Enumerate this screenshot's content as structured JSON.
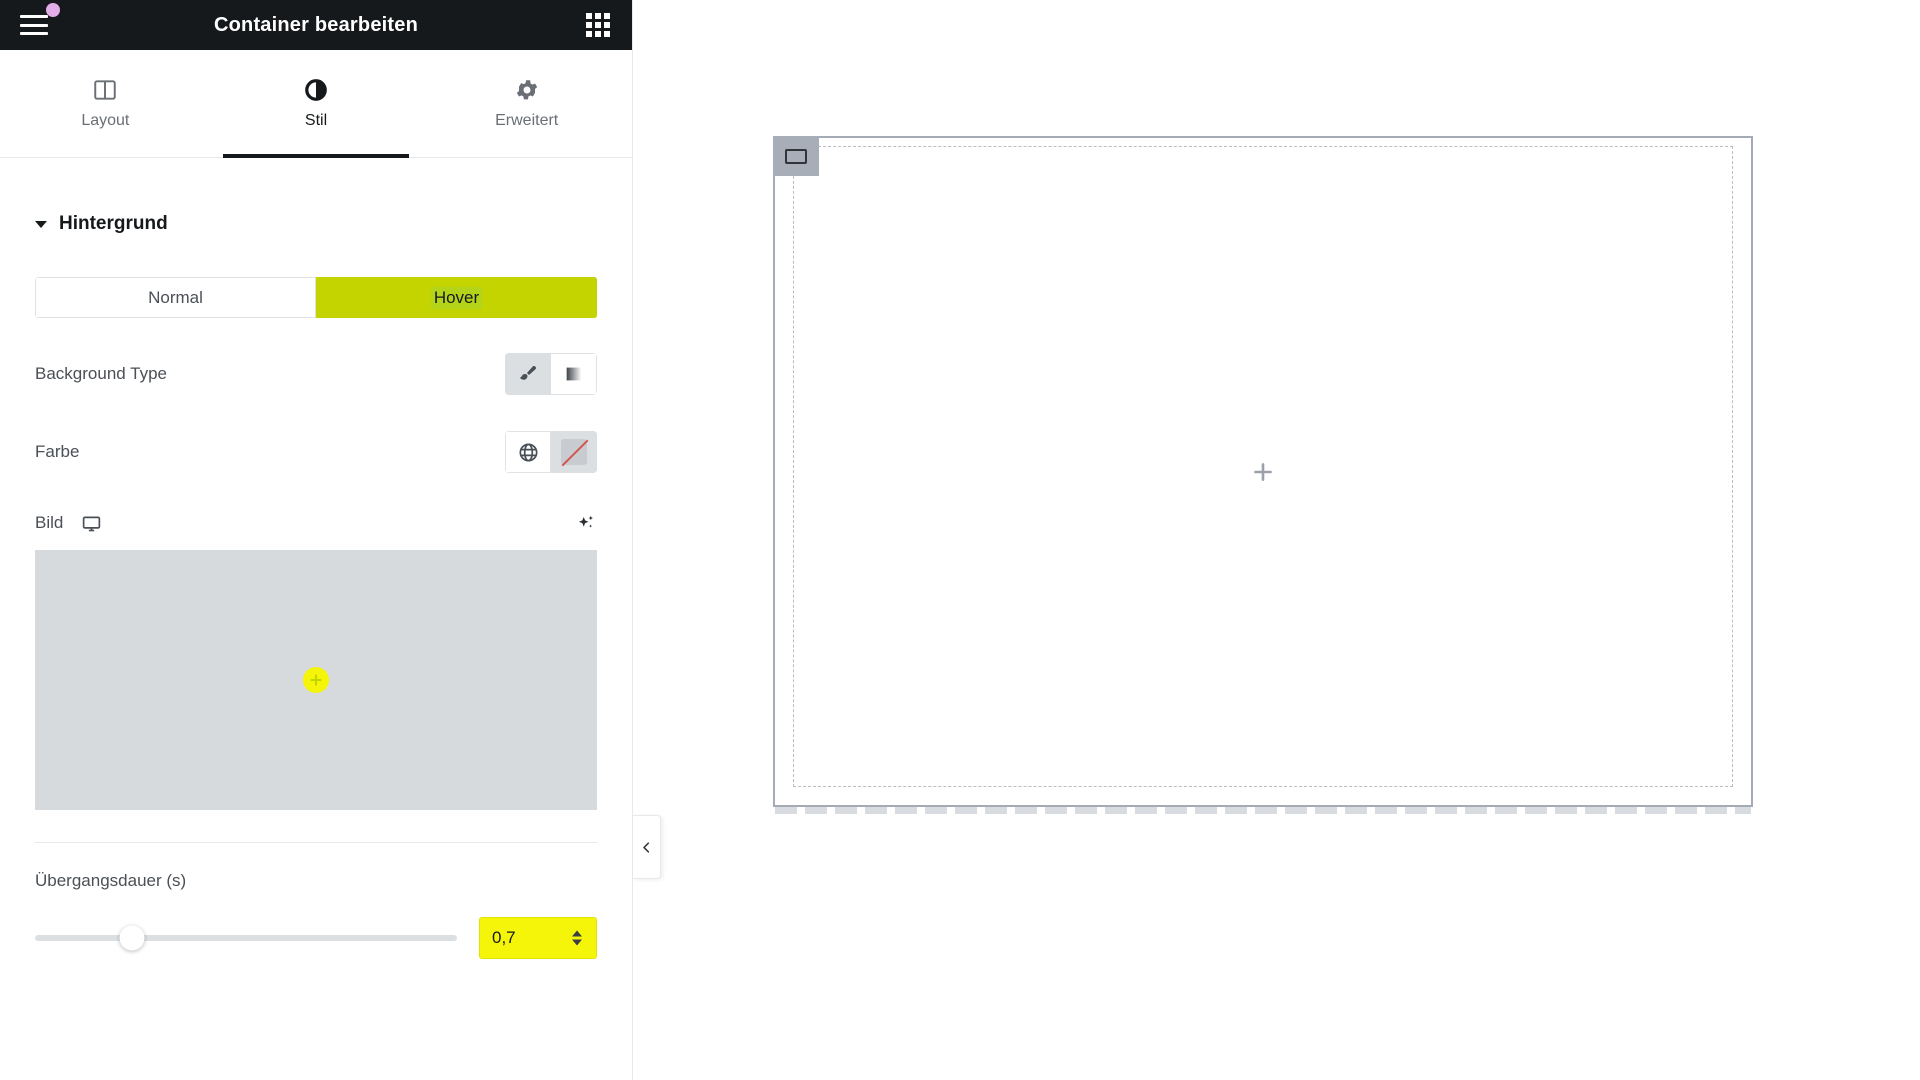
{
  "panel": {
    "header": {
      "title": "Container bearbeiten",
      "menu_icon": "hamburger-menu-icon",
      "notification_dot": "notification-dot",
      "widgets_icon": "grid-widgets-icon"
    },
    "tabs": [
      {
        "id": "layout",
        "label": "Layout",
        "icon": "columns-layout-icon",
        "active": false
      },
      {
        "id": "stil",
        "label": "Stil",
        "icon": "contrast-style-icon",
        "active": true
      },
      {
        "id": "erweitert",
        "label": "Erweitert",
        "icon": "gear-advanced-icon",
        "active": false
      }
    ],
    "section": {
      "title": "Hintergrund",
      "collapsed": false,
      "caret_icon": "caret-down-icon"
    },
    "state_switch": {
      "options": [
        "Normal",
        "Hover"
      ],
      "selected": "Hover"
    },
    "background_type": {
      "label": "Background Type",
      "options": [
        {
          "id": "classic",
          "icon": "paintbrush-icon",
          "selected": true
        },
        {
          "id": "gradient",
          "icon": "gradient-square-icon",
          "selected": false
        }
      ]
    },
    "color": {
      "label": "Farbe",
      "options": [
        {
          "id": "global",
          "icon": "globe-icon",
          "selected": false
        },
        {
          "id": "none",
          "icon": "no-color-swatch-icon",
          "selected": true
        }
      ]
    },
    "image": {
      "label": "Bild",
      "device_icon": "desktop-monitor-icon",
      "ai_icon": "ai-sparkle-icon",
      "placeholder_icon": "plus-circle-icon"
    },
    "transition": {
      "label": "Übergangsdauer (s)",
      "value": "0,7",
      "slider_percent": 23,
      "spinner_up_icon": "chevron-up-icon",
      "spinner_down_icon": "chevron-down-icon"
    },
    "collapse_icon": "chevron-left-icon"
  },
  "canvas": {
    "container_handle_icon": "container-rect-icon",
    "add_widget_icon": "plus-icon",
    "resize_handle": "resize-strip"
  },
  "colors": {
    "header_bg": "#16191b",
    "accent_hover": "#c3d400",
    "accent_yellow": "#f5f50a",
    "notif_pink": "#e3aee8",
    "media_bg": "#d7dadd",
    "border": "#e6e9ec",
    "canvas_border": "#a4abb4"
  }
}
